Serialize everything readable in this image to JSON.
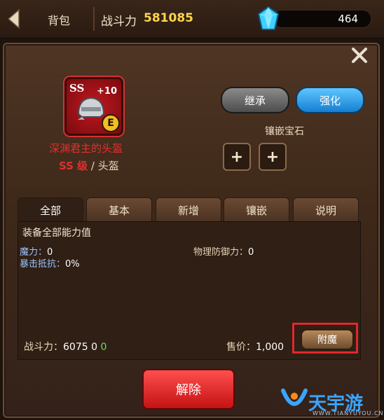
{
  "topbar": {
    "title": "背包",
    "power_label": "战斗力",
    "power_value": "581085",
    "gem_count": "464"
  },
  "item": {
    "grade": "SS",
    "plus": "+10",
    "rank_badge": "E",
    "name": "深渊君主的头盔",
    "rank_label": "SS 级",
    "slash": " / ",
    "type": "头盔"
  },
  "actions": {
    "inherit": "继承",
    "enhance": "强化",
    "inlay_label": "镶嵌宝石",
    "slot_plus": "+"
  },
  "tabs": [
    {
      "label": "全部",
      "active": true
    },
    {
      "label": "基本",
      "active": false
    },
    {
      "label": "新增",
      "active": false
    },
    {
      "label": "镶嵌",
      "active": false
    },
    {
      "label": "说明",
      "active": false
    }
  ],
  "content": {
    "title": "装备全部能力值",
    "stats": {
      "magic_label": "魔力：",
      "magic_value": "0",
      "crit_label": "暴击抵抗：",
      "crit_value": "0%",
      "phys_label": "物理防御力：",
      "phys_value": "0"
    },
    "footer": {
      "power_label": "战斗力：",
      "power_value": "6075 0 ",
      "power_delta": "0",
      "price_label": "售价：",
      "price_value": "1,000"
    },
    "enchant": "附魔"
  },
  "release": "解除",
  "watermark": {
    "name": "天宇游",
    "url": "WWW.TIANYUYOU.CN"
  }
}
